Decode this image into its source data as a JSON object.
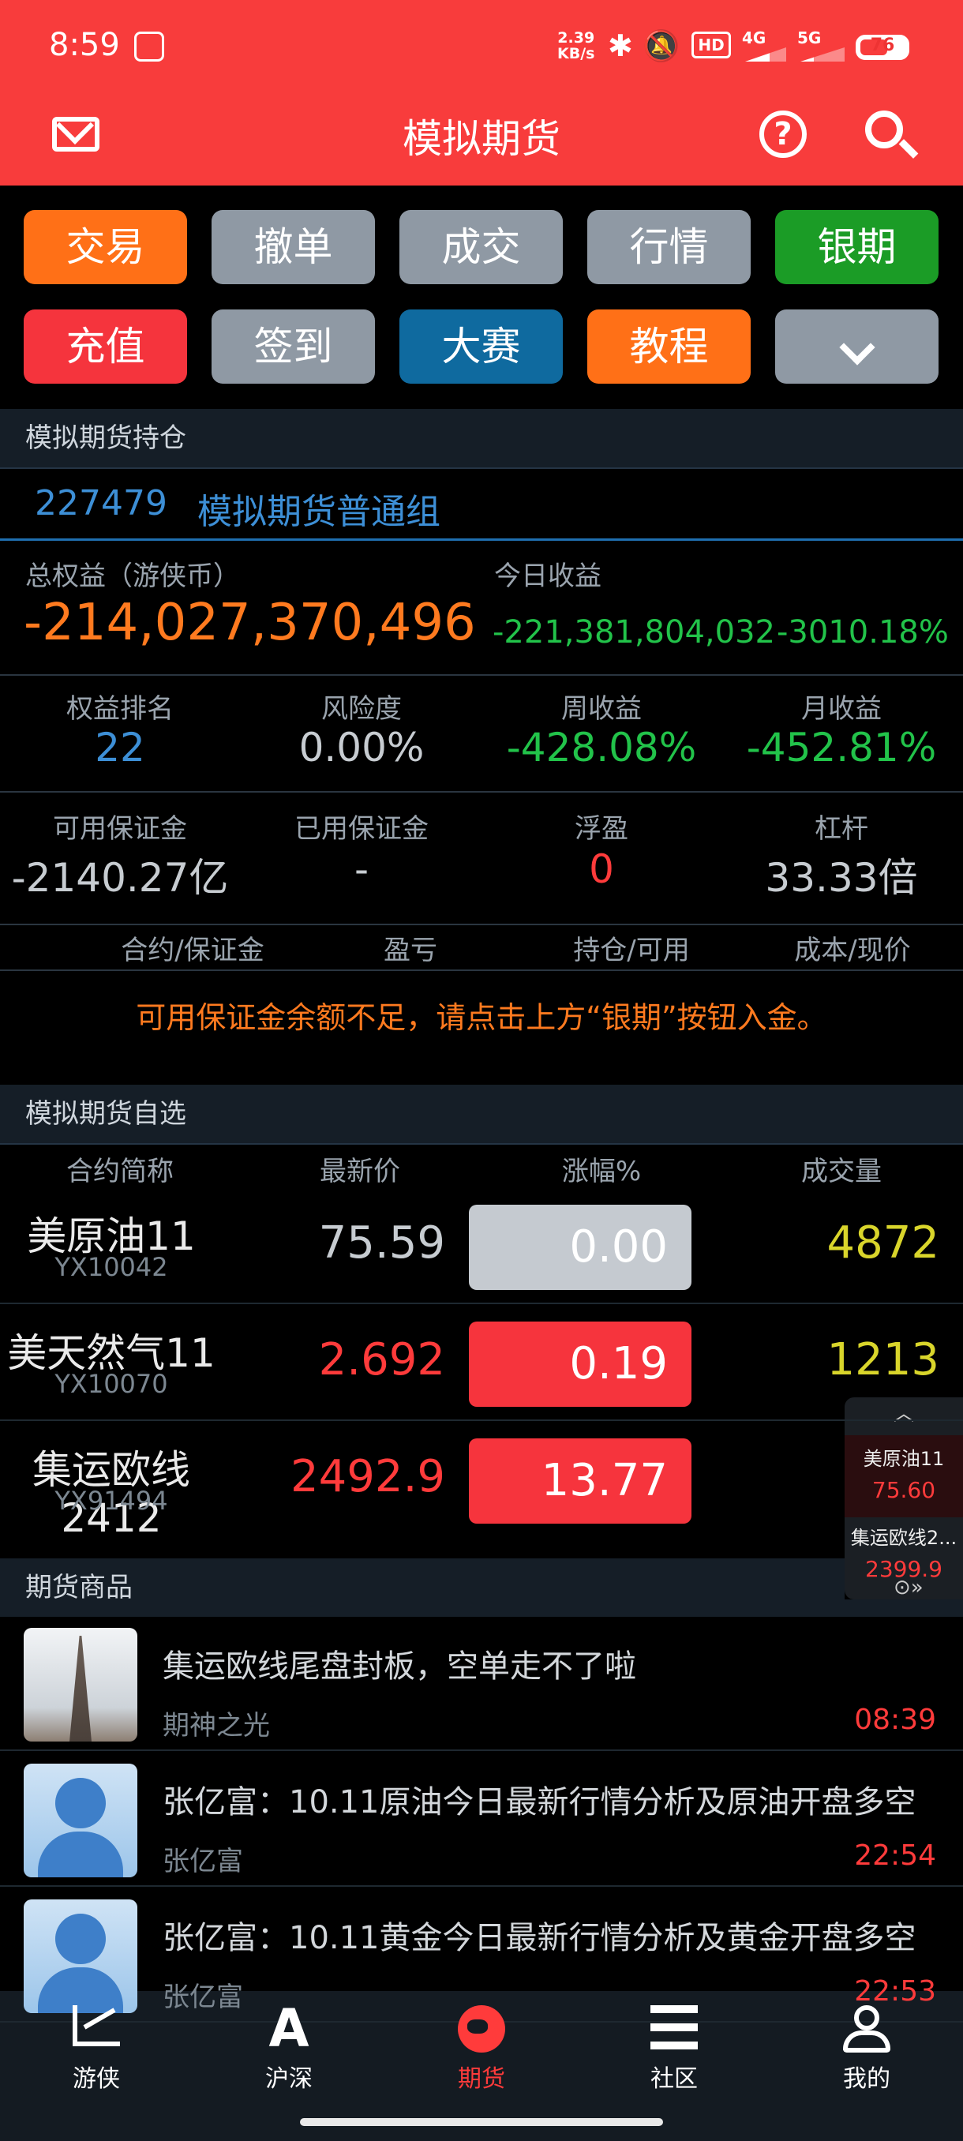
{
  "status_bar": {
    "time": "8:59",
    "speed": "2.39",
    "speed_unit": "KB/s",
    "hd_badge": "HD",
    "network_1": "4G",
    "network_2": "5G",
    "battery": "76"
  },
  "header": {
    "title": "模拟期货",
    "icons": [
      "mail-icon",
      "help-icon",
      "search-icon"
    ],
    "color": "#f83c3c"
  },
  "quick_buttons": [
    {
      "label": "交易",
      "color": "#ff7017"
    },
    {
      "label": "撤单",
      "color": "#8f99a4"
    },
    {
      "label": "成交",
      "color": "#8f99a4"
    },
    {
      "label": "行情",
      "color": "#8f99a4"
    },
    {
      "label": "银期",
      "color": "#1b9c26"
    },
    {
      "label": "充值",
      "color": "#f5343d"
    },
    {
      "label": "签到",
      "color": "#8f99a4"
    },
    {
      "label": "大赛",
      "color": "#0f6a9f"
    },
    {
      "label": "教程",
      "color": "#ff7017"
    },
    {
      "label": "",
      "icon": "chevron-down-icon",
      "color": "#8f99a4"
    }
  ],
  "holdings": {
    "section_title": "模拟期货持仓",
    "account_id": "227479",
    "group_name": "模拟期货普通组",
    "total_equity_label": "总权益（游侠币）",
    "total_equity": "-214,027,370,496",
    "today_income_label": "今日收益",
    "today_income": "-221,381,804,032",
    "today_income_pct": "-3010.18%",
    "stats_row_1": [
      {
        "label": "权益排名",
        "value": "22"
      },
      {
        "label": "风险度",
        "value": "0.00%"
      },
      {
        "label": "周收益",
        "value": "-428.08%"
      },
      {
        "label": "月收益",
        "value": "-452.81%"
      }
    ],
    "stats_row_2": [
      {
        "label": "可用保证金",
        "value": "-2140.27亿"
      },
      {
        "label": "已用保证金",
        "value": "-"
      },
      {
        "label": "浮盈",
        "value": "0"
      },
      {
        "label": "杠杆",
        "value": "33.33倍"
      }
    ],
    "table_headers": [
      "合约/保证金",
      "盈亏",
      "持仓/可用",
      "成本/现价"
    ],
    "notice": "可用保证金余额不足，请点击上方“银期”按钮入金。"
  },
  "watchlist": {
    "section_title": "模拟期货自选",
    "headers": [
      "合约简称",
      "最新价",
      "涨幅%",
      "成交量"
    ],
    "rows": [
      {
        "name": "美原油11",
        "code": "YX10042",
        "price": "75.59",
        "change": "0.00",
        "volume": "4872"
      },
      {
        "name": "美天然气11",
        "code": "YX10070",
        "price": "2.692",
        "change": "0.19",
        "volume": "1213"
      },
      {
        "name": "集运欧线2412",
        "code": "YX91494",
        "price": "2492.9",
        "change": "13.77",
        "volume": ""
      }
    ]
  },
  "float_widget": {
    "items": [
      {
        "name": "美原油11",
        "price": "75.60"
      },
      {
        "name": "集运欧线2...",
        "price": "2399.9"
      }
    ]
  },
  "news": {
    "section_title": "期货商品",
    "items": [
      {
        "title": "集运欧线尾盘封板，空单走不了啦",
        "source": "期神之光",
        "time": "08:39",
        "thumb": "eiffel-tower-photo"
      },
      {
        "title": "张亿富：10.11原油今日最新行情分析及原油开盘多空",
        "source": "张亿富",
        "time": "22:54",
        "thumb": "avatar-placeholder"
      },
      {
        "title": "张亿富：10.11黄金今日最新行情分析及黄金开盘多空",
        "source": "张亿富",
        "time": "22:53",
        "thumb": "avatar-placeholder"
      }
    ]
  },
  "bottom_nav": [
    {
      "label": "游侠",
      "icon": "chart-icon",
      "active": false
    },
    {
      "label": "沪深",
      "icon": "letter-a-icon",
      "active": false
    },
    {
      "label": "期货",
      "icon": "globe-icon",
      "active": true
    },
    {
      "label": "社区",
      "icon": "list-icon",
      "active": false
    },
    {
      "label": "我的",
      "icon": "user-icon",
      "active": false
    }
  ]
}
